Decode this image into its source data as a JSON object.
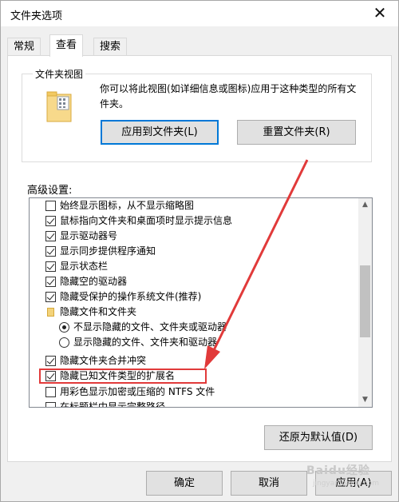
{
  "window": {
    "title": "文件夹选项",
    "close_glyph": "✕"
  },
  "tabs": [
    {
      "label": "常规",
      "active": false
    },
    {
      "label": "查看",
      "active": true
    },
    {
      "label": "搜索",
      "active": false
    }
  ],
  "folder_views": {
    "legend": "文件夹视图",
    "description": "你可以将此视图(如详细信息或图标)应用于这种类型的所有文件夹。",
    "apply_button": "应用到文件夹(L)",
    "reset_button": "重置文件夹(R)"
  },
  "advanced": {
    "label": "高级设置:",
    "items": [
      {
        "type": "checkbox",
        "checked": false,
        "label": "始终显示图标，从不显示缩略图",
        "indent": 0
      },
      {
        "type": "checkbox",
        "checked": true,
        "label": "鼠标指向文件夹和桌面项时显示提示信息",
        "indent": 0
      },
      {
        "type": "checkbox",
        "checked": true,
        "label": "显示驱动器号",
        "indent": 0
      },
      {
        "type": "checkbox",
        "checked": true,
        "label": "显示同步提供程序通知",
        "indent": 0
      },
      {
        "type": "checkbox",
        "checked": true,
        "label": "显示状态栏",
        "indent": 0
      },
      {
        "type": "checkbox",
        "checked": true,
        "label": "隐藏空的驱动器",
        "indent": 0
      },
      {
        "type": "checkbox",
        "checked": true,
        "label": "隐藏受保护的操作系统文件(推荐)",
        "indent": 0
      },
      {
        "type": "folder",
        "checked": false,
        "label": "隐藏文件和文件夹",
        "indent": 0
      },
      {
        "type": "radio",
        "checked": true,
        "label": "不显示隐藏的文件、文件夹或驱动器",
        "indent": 1
      },
      {
        "type": "radio",
        "checked": false,
        "label": "显示隐藏的文件、文件夹和驱动器",
        "indent": 1
      },
      {
        "type": "checkbox",
        "checked": true,
        "label": "隐藏文件夹合并冲突",
        "indent": 0
      },
      {
        "type": "checkbox",
        "checked": true,
        "label": "隐藏已知文件类型的扩展名",
        "indent": 0
      },
      {
        "type": "checkbox",
        "checked": false,
        "label": "用彩色显示加密或压缩的 NTFS 文件",
        "indent": 0
      },
      {
        "type": "checkbox",
        "checked": false,
        "label": "在标题栏中显示完整路径",
        "indent": 0
      }
    ],
    "restore_button": "还原为默认值(D)"
  },
  "footer": {
    "ok": "确定",
    "cancel": "取消",
    "apply": "应用(A)"
  },
  "annotation": {
    "highlight_color": "#e13a3a",
    "arrow_color": "#e13a3a"
  },
  "watermark": {
    "text": "Baidu经验",
    "url": "jingyan.baidu.com"
  }
}
